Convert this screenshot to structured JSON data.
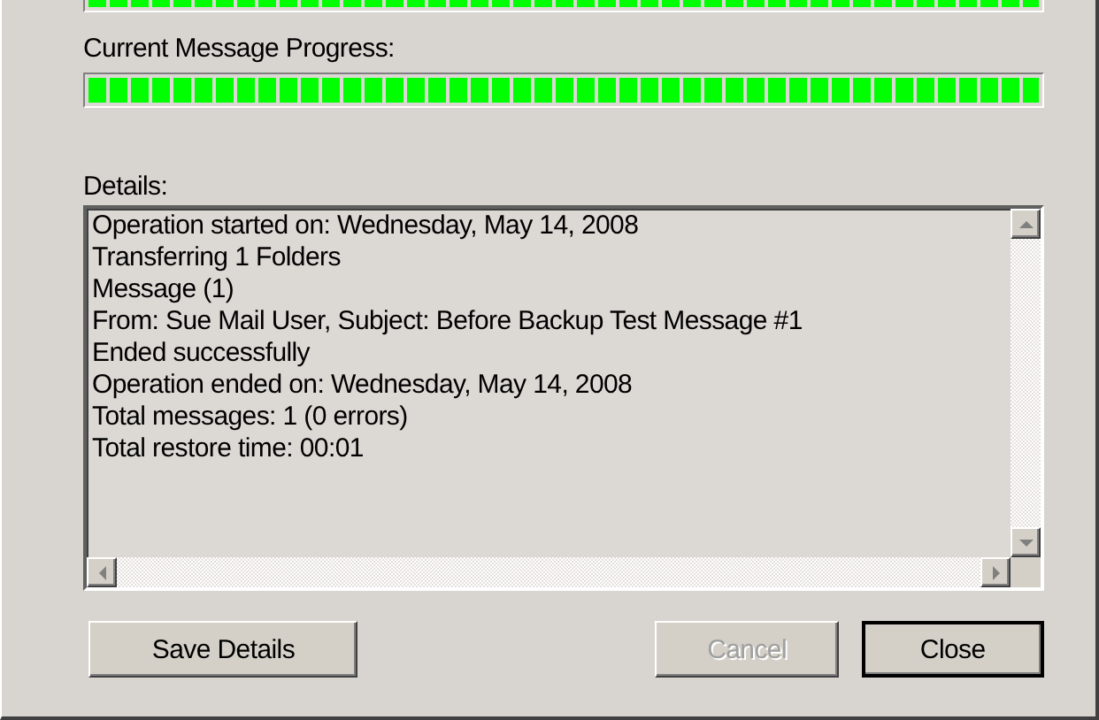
{
  "overall_progress": {
    "level": 1
  },
  "current_message_progress": {
    "label": "Current Message Progress:",
    "level": 1
  },
  "details": {
    "label": "Details:",
    "lines": [
      "Operation started on: Wednesday, May 14, 2008",
      "Transferring 1 Folders",
      "Message (1)",
      "From: Sue Mail User, Subject: Before Backup Test Message #1",
      "Ended successfully",
      "Operation ended on: Wednesday, May 14, 2008",
      "Total messages: 1 (0 errors)",
      "Total restore time: 00:01"
    ]
  },
  "buttons": [
    {
      "label": "Save Details",
      "disabled": false,
      "default": false
    },
    {
      "label": "Cancel",
      "disabled": true,
      "default": false
    },
    {
      "label": "Close",
      "disabled": false,
      "default": true
    }
  ]
}
